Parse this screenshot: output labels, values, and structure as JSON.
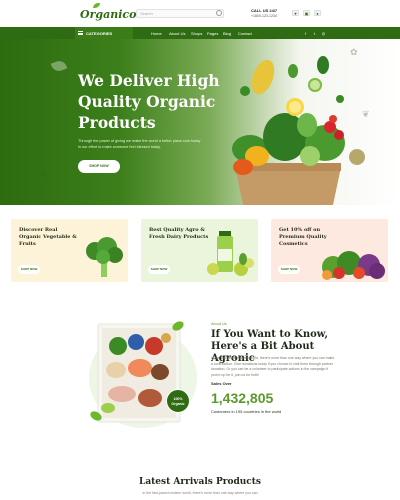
{
  "header": {
    "logo": "Organico",
    "search_placeholder": "Search",
    "call_label": "CALL US 24/7",
    "call_number": "+1800-123-1234",
    "icons": [
      "heart-icon",
      "cart-icon",
      "user-icon"
    ]
  },
  "nav": {
    "categories_label": "CATEGORIES",
    "links": [
      "Home",
      "About Us",
      "Shops",
      "Pages",
      "Blog",
      "Contact"
    ],
    "social": [
      "facebook-icon",
      "twitter-icon",
      "instagram-icon"
    ]
  },
  "hero": {
    "title": "We Deliver High Quality Organic Products",
    "description": "Through the power of giving we make the world a better place.com today in our effort to make someone feel blessed today.",
    "button": "SHOP NOW"
  },
  "promo_cards": [
    {
      "title": "Discover Real Organic Vegetable & Fruits",
      "button": "SHOP NOW",
      "bg": "#fdf3d8"
    },
    {
      "title": "Best Quality Agro & Fresh Dairy Products",
      "button": "SHOP NOW",
      "bg": "#eaf5dc"
    },
    {
      "title": "Get 10% off on Premium Quality Cosmetics",
      "button": "SHOP NOW",
      "bg": "#fde9df"
    }
  ],
  "about": {
    "tag": "About Us",
    "title": "If You Want to Know, Here's a Bit About Agronic",
    "text": "In the last years modern world, there's more than one way where you can make a contribution. Give donations today if you choose to visit them through partner donation. Or you can be a volunteer to participate actions in the campaign if you're up for it, join us for both!",
    "sales_label": "Sales Over",
    "sales_value": "1,432,805",
    "customers": "Customers in 195 countries in the world",
    "badge": "100% Organic"
  },
  "latest": {
    "title": "Latest Arrivals Products",
    "subtitle": "In the fast-paced modern world, there's more than one way where you can"
  },
  "colors": {
    "brand_green": "#2f6b12",
    "accent_green": "#5a9a2a",
    "white": "#ffffff"
  }
}
